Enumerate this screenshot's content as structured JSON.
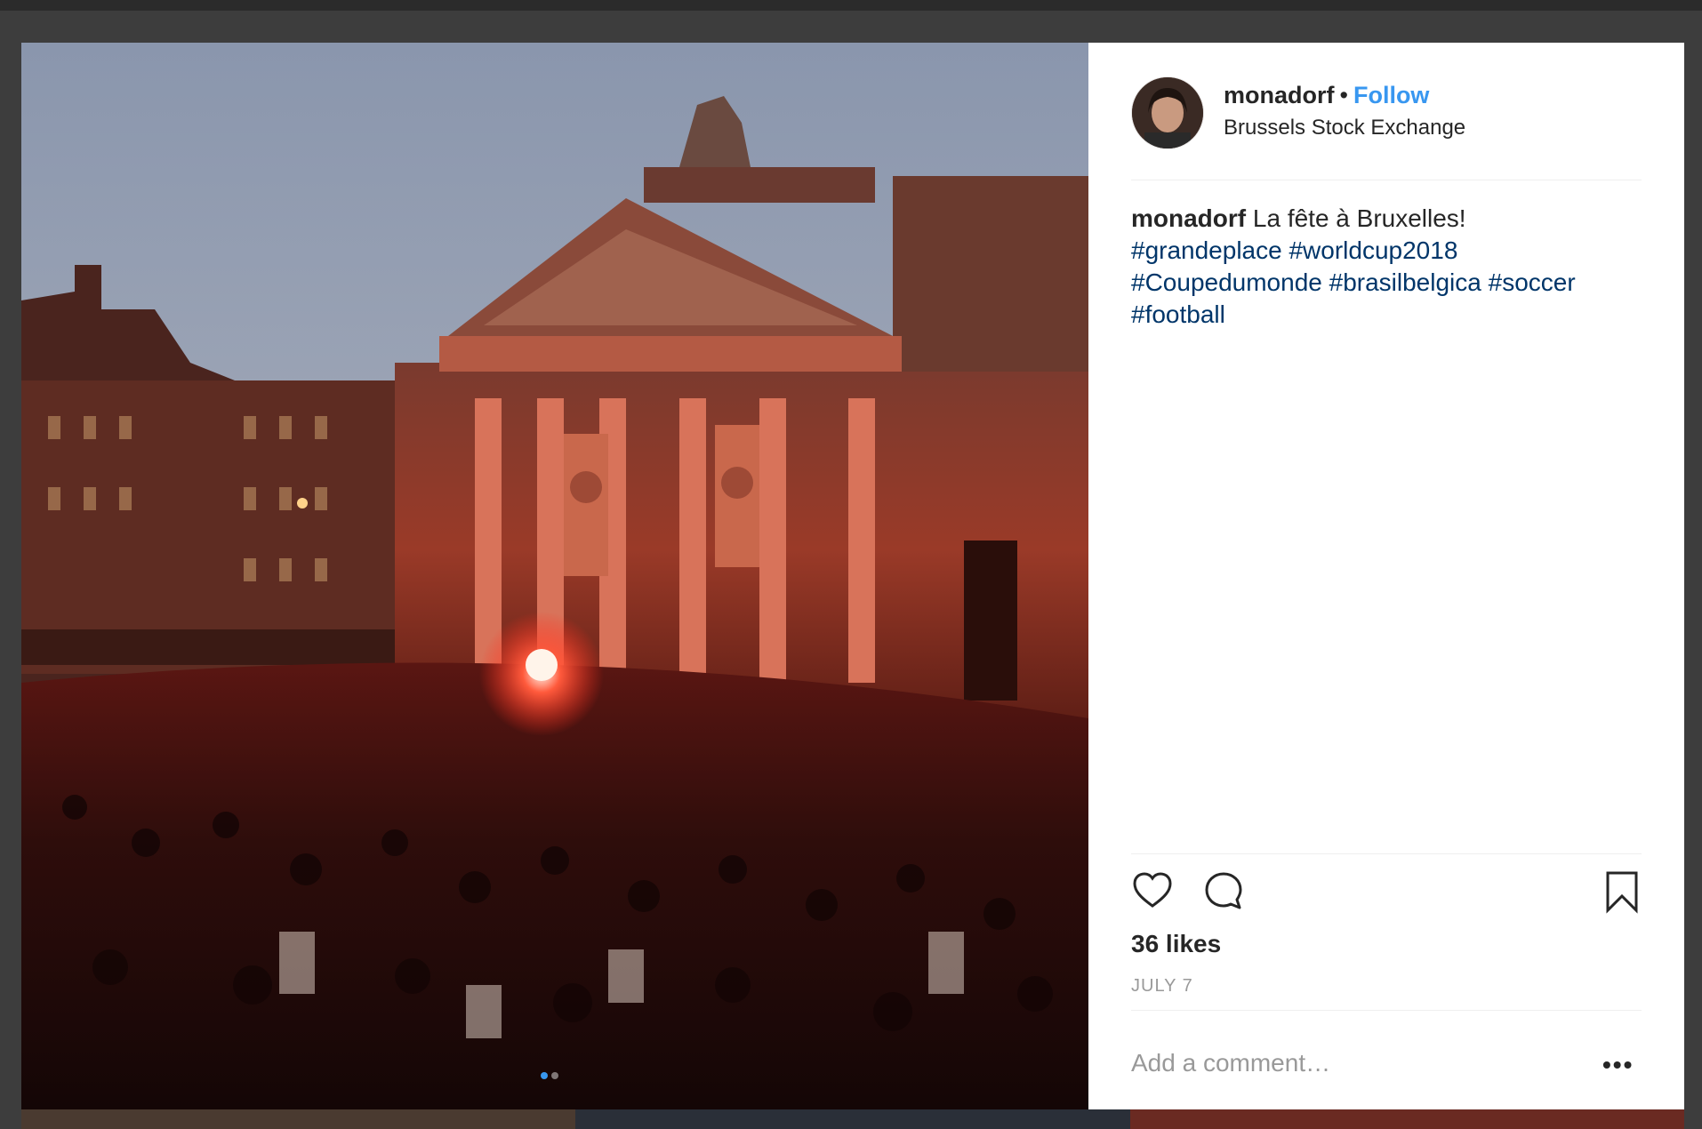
{
  "post": {
    "username": "monadorf",
    "separator": "•",
    "follow_label": "Follow",
    "location": "Brussels Stock Exchange",
    "caption": {
      "username": "monadorf",
      "text": "La fête à Bruxelles!",
      "hashtags": [
        "#grandeplace",
        "#worldcup2018",
        "#Coupedumonde",
        "#brasilbelgica",
        "#soccer",
        "#football"
      ]
    },
    "likes": "36 likes",
    "date": "JULY 7",
    "comment_placeholder": "Add a comment…",
    "more_label": "•••",
    "carousel": {
      "count": 2,
      "active": 0
    }
  },
  "icons": {
    "like": "heart-icon",
    "comment": "comment-bubble-icon",
    "save": "bookmark-icon",
    "more": "more-options-icon"
  },
  "colors": {
    "link": "#3897f0",
    "hashtag": "#003569",
    "text": "#262626",
    "muted": "#999999",
    "backdrop": "#3d3d3d"
  }
}
